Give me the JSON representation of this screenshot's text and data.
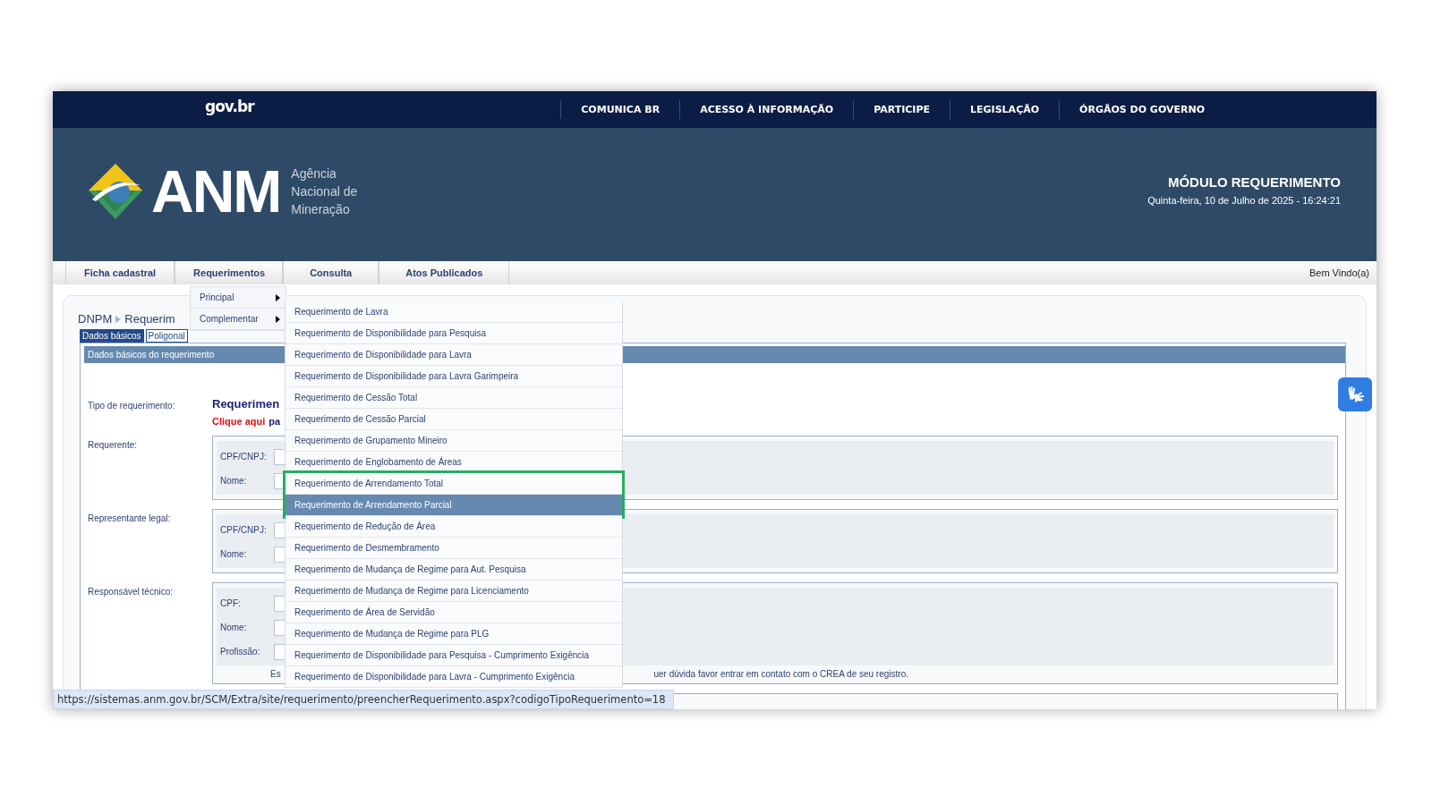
{
  "gov_bar": {
    "logo": "gov.br",
    "links": [
      "COMUNICA BR",
      "ACESSO À INFORMAÇÃO",
      "PARTICIPE",
      "LEGISLAÇÃO",
      "ÓRGÃOS DO GOVERNO"
    ]
  },
  "header": {
    "acronym": "ANM",
    "agency": "Agência Nacional de Mineração",
    "module": "MÓDULO REQUERIMENTO",
    "datetime": "Quinta-feira, 10 de Julho de 2025 - 16:24:21"
  },
  "menu": {
    "items": [
      "Ficha cadastral",
      "Requerimentos",
      "Consulta",
      "Atos Publicados"
    ],
    "welcome": "Bem Vindo(a)"
  },
  "submenu": [
    "Principal",
    "Complementar"
  ],
  "dropdown": [
    {
      "label": "Requerimento de Lavra",
      "selected": false,
      "outlined": false
    },
    {
      "label": "Requerimento de Disponibilidade para Pesquisa",
      "selected": false,
      "outlined": false
    },
    {
      "label": "Requerimento de Disponibilidade para Lavra",
      "selected": false,
      "outlined": false
    },
    {
      "label": "Requerimento de Disponibilidade para Lavra Garimpeira",
      "selected": false,
      "outlined": false
    },
    {
      "label": "Requerimento de Cessão Total",
      "selected": false,
      "outlined": false
    },
    {
      "label": "Requerimento de Cessão Parcial",
      "selected": false,
      "outlined": false
    },
    {
      "label": "Requerimento de Grupamento Mineiro",
      "selected": false,
      "outlined": false
    },
    {
      "label": "Requerimento de Englobamento de Áreas",
      "selected": false,
      "outlined": false
    },
    {
      "label": "Requerimento de Arrendamento Total",
      "selected": false,
      "outlined": true
    },
    {
      "label": "Requerimento de Arrendamento Parcial",
      "selected": true,
      "outlined": true
    },
    {
      "label": "Requerimento de Redução de Área",
      "selected": false,
      "outlined": false
    },
    {
      "label": "Requerimento de Desmembramento",
      "selected": false,
      "outlined": false
    },
    {
      "label": "Requerimento de Mudança de Regime para Aut. Pesquisa",
      "selected": false,
      "outlined": false
    },
    {
      "label": "Requerimento de Mudança de Regime para Licenciamento",
      "selected": false,
      "outlined": false
    },
    {
      "label": "Requerimento de Área de Servidão",
      "selected": false,
      "outlined": false
    },
    {
      "label": "Requerimento de Mudança de Regime para PLG",
      "selected": false,
      "outlined": false
    },
    {
      "label": "Requerimento de Disponibilidade para Pesquisa - Cumprimento Exigência",
      "selected": false,
      "outlined": false
    },
    {
      "label": "Requerimento de Disponibilidade para Lavra - Cumprimento Exigência",
      "selected": false,
      "outlined": false
    }
  ],
  "breadcrumb": {
    "root": "DNPM",
    "current": "Requerim"
  },
  "tabs": [
    {
      "label": "Dados básicos",
      "selected": true
    },
    {
      "label": "Poligonal",
      "selected": false
    }
  ],
  "section": {
    "title": "Dados básicos do requerimento",
    "type_label": "Tipo de requerimento:",
    "type_value": "Requerimen",
    "link": "Clique aqui",
    "link_rest": "pa",
    "groups": [
      {
        "label": "Requerente:",
        "fields": [
          "CPF/CNPJ:",
          "Nome:"
        ]
      },
      {
        "label": "Representante legal:",
        "fields": [
          "CPF/CNPJ:",
          "Nome:"
        ]
      },
      {
        "label": "Responsável técnico:",
        "fields": [
          "CPF:",
          "Nome:",
          "Profissão:"
        ],
        "note_start": "Es",
        "note_end": "uer dúvida favor entrar em contato com o CREA de seu registro."
      }
    ]
  },
  "status_url": "https://sistemas.anm.gov.br/SCM/Extra/site/requerimento/preencherRequerimento.aspx?codigoTipoRequerimento=18"
}
